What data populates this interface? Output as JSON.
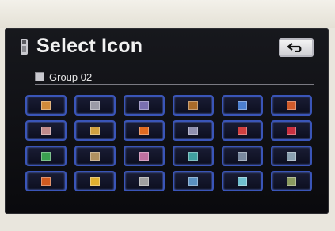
{
  "header": {
    "title": "Select Icon",
    "title_icon": "phone-handset-icon",
    "back_icon": "return-arrow-icon"
  },
  "group": {
    "label": "Group 02"
  },
  "icons": [
    {
      "color": "#d08a3a"
    },
    {
      "color": "#9a9aa6"
    },
    {
      "color": "#7a6fb0"
    },
    {
      "color": "#a86a2a"
    },
    {
      "color": "#4c7fd0"
    },
    {
      "color": "#d05a2a"
    },
    {
      "color": "#c08a8a"
    },
    {
      "color": "#d0a040"
    },
    {
      "color": "#e06a20"
    },
    {
      "color": "#9090b0"
    },
    {
      "color": "#d04040"
    },
    {
      "color": "#c83040"
    },
    {
      "color": "#3aa050"
    },
    {
      "color": "#b09060"
    },
    {
      "color": "#c070a0"
    },
    {
      "color": "#40a0a0"
    },
    {
      "color": "#7a8aa0"
    },
    {
      "color": "#8aa0b0"
    },
    {
      "color": "#d05a20"
    },
    {
      "color": "#e0b030"
    },
    {
      "color": "#a0a0a0"
    },
    {
      "color": "#5a90c0"
    },
    {
      "color": "#70c0d0"
    },
    {
      "color": "#8a9a60"
    }
  ],
  "colors": {
    "button_border": "#3a55b8",
    "screen_bg": "#0a0a0d"
  }
}
